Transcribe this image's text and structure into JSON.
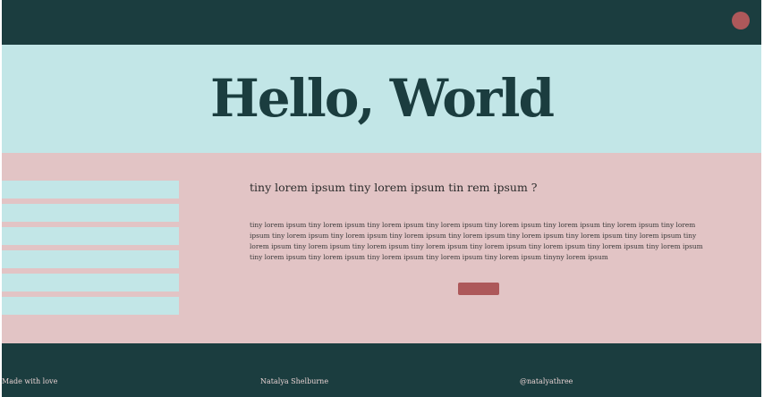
{
  "colors": {
    "dark": "#1b3d3f",
    "teal_light": "#c2e6e7",
    "pink_light": "#e2c4c5",
    "accent": "#ad585a"
  },
  "header": {
    "avatar_icon": "circle-avatar-icon"
  },
  "hero": {
    "title": "Hello, World"
  },
  "sidebar": {
    "items": [
      "",
      "",
      "",
      "",
      "",
      ""
    ]
  },
  "main": {
    "heading": "tiny lorem ipsum tiny lorem ipsum tin rem ipsum ?",
    "body": "tiny lorem ipsum tiny lorem ipsum tiny lorem ipsum tiny lorem ipsum tiny lorem ipsum tiny lorem ipsum tiny lorem ipsum tiny lorem ipsum tiny lorem ipsum tiny lorem ipsum tiny lorem ipsum tiny lorem ipsum tiny lorem ipsum tiny lorem ipsum tiny lorem ipsum tiny lorem ipsum tiny lorem ipsum tiny lorem ipsum tiny lorem ipsum tiny lorem ipsum tiny lorem ipsum tiny lorem ipsum tiny lorem ipsum tiny lorem ipsum tiny lorem ipsum tiny lorem ipsum tiny lorem ipsum tiny lorem ipsum tinyny lorem ipsum",
    "button_label": ""
  },
  "footer": {
    "left": "Made with love",
    "center": "Natalya Shelburne",
    "right": "@natalyathree"
  }
}
